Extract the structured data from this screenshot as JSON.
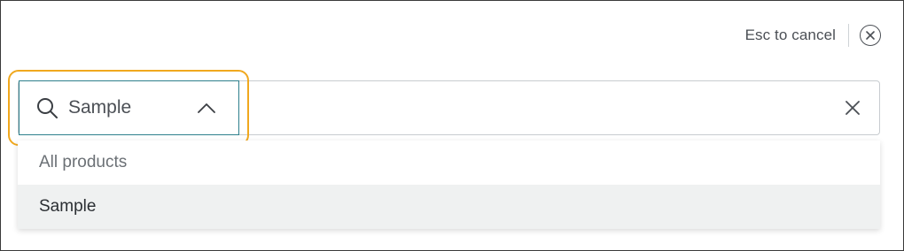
{
  "topbar": {
    "esc_label": "Esc to cancel",
    "close_icon": "close-circle-icon"
  },
  "scope_select": {
    "value": "Sample",
    "icon": "search-icon",
    "chevron": "chevron-up-icon",
    "highlight_color": "#f0a81e",
    "border_color": "#2d7f8c"
  },
  "search_input": {
    "value": "",
    "clear_icon": "clear-x-icon"
  },
  "dropdown": {
    "items": [
      {
        "label": "All products"
      },
      {
        "label": "Sample"
      }
    ],
    "selected_index": 1
  }
}
